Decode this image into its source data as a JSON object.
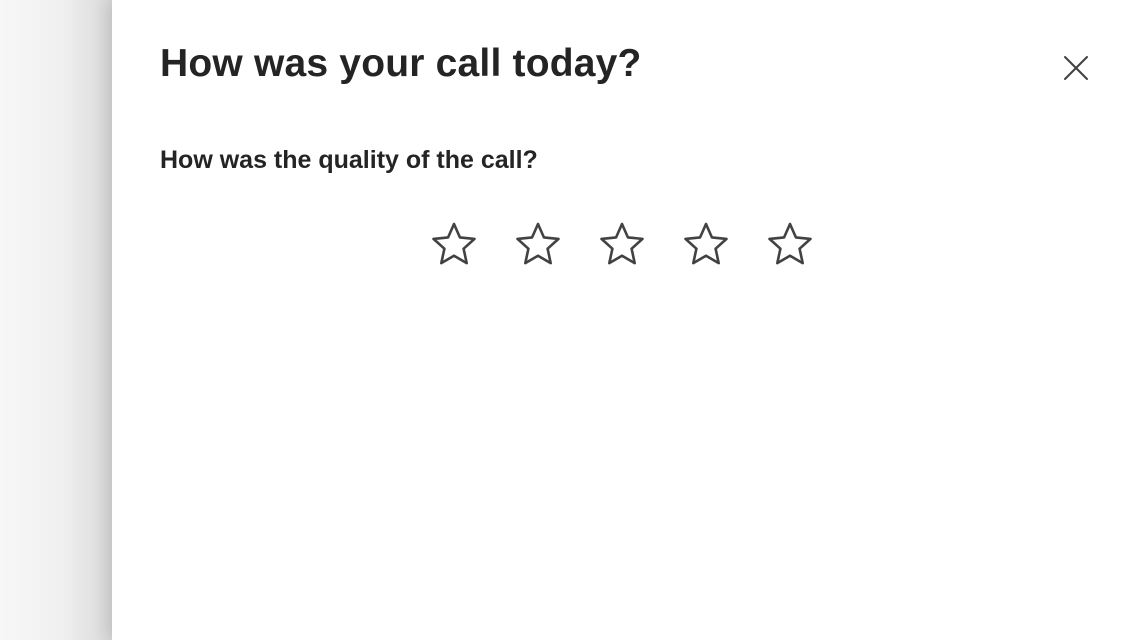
{
  "dialog": {
    "title": "How was your call today?",
    "close_icon": "close-icon"
  },
  "question": {
    "label": "How was the quality of the call?"
  },
  "rating": {
    "max": 5,
    "value": 0,
    "star_icon": "star-outline-icon",
    "colors": {
      "outline": "#424242"
    }
  }
}
